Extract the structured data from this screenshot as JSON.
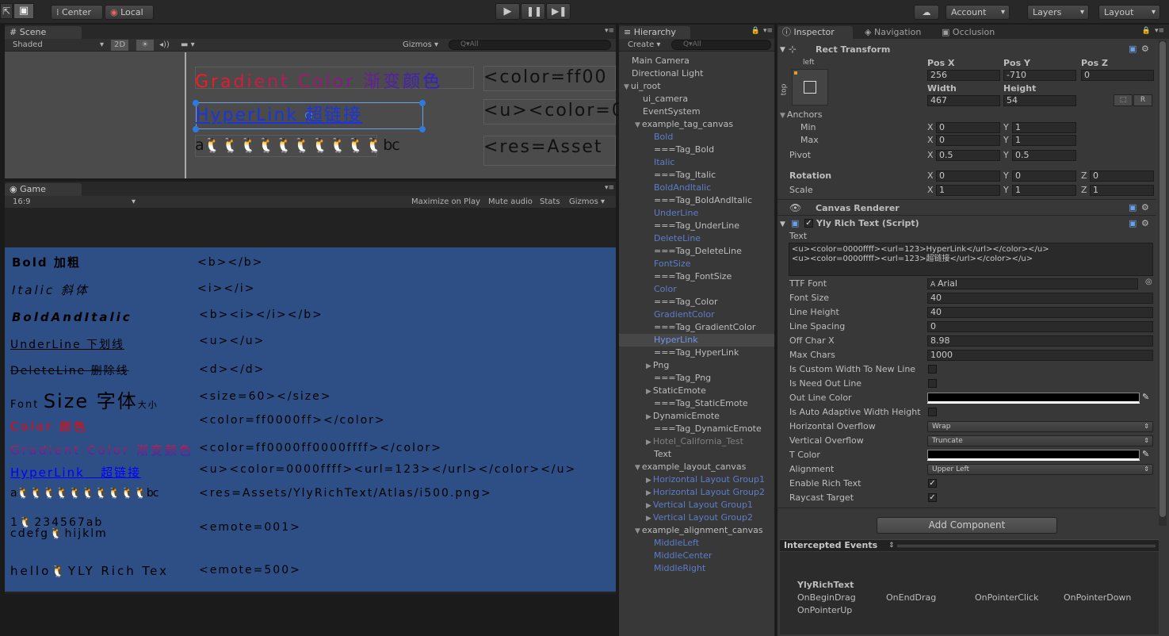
{
  "toolbar": {
    "pivot": "Center",
    "space": "Local",
    "account": "Account",
    "layers": "Layers",
    "layout": "Layout"
  },
  "scene": {
    "tab": "Scene",
    "shading": "Shaded",
    "mode2d": "2D",
    "gizmos": "Gizmos",
    "search_placeholder": "Q▾All",
    "left": [
      {
        "text": "Gradient Color 渐变颜色",
        "color": "#2b1fd0"
      },
      {
        "text": "HyperLink  超链接",
        "color": "#1a35e0"
      },
      {
        "text": "a🐧🐧🐧🐧🐧🐧🐧🐧🐧🐧bc",
        "color": "#111111"
      }
    ],
    "right": [
      "<color=ff00",
      "<u><color=0",
      "<res=Asset"
    ]
  },
  "game": {
    "tab": "Game",
    "aspect": "16:9",
    "maximize": "Maximize on Play",
    "mute": "Mute audio",
    "stats": "Stats",
    "gizmos": "Gizmos",
    "rows": [
      {
        "left": "Bold  加粗",
        "tag": "<b></b>"
      },
      {
        "left": "Italic  斜体",
        "tag": "<i></i>"
      },
      {
        "left": "BoldAndItalic",
        "tag": "<b><i></i></b>"
      },
      {
        "left": "UnderLine  下划线",
        "tag": "<u></u>"
      },
      {
        "left": "DeleteLine  删除线",
        "tag": "<d></d>"
      },
      {
        "left_small": "Font",
        "left_big": "Size  字体",
        "left_tail": "大小",
        "tag": "<size=60></size>"
      },
      {
        "left": "Color  颜色",
        "tag": "<color=ff0000ff></color>"
      },
      {
        "left": "Gradient Color  渐变颜色",
        "tag": "<color=ff0000ff0000ffff></color>"
      },
      {
        "left_a": "HyperLink",
        "left_b": "超链接",
        "tag": "<u><color=0000ffff><url=123></url></color></u>"
      },
      {
        "left": "a🐧🐧🐧🐧🐧🐧🐧🐧🐧🐧bc",
        "tag": "<res=Assets/YlyRichText/Atlas/i500.png>"
      },
      {
        "left1": "1🐧234567ab",
        "left2": "cdefg🐧hijklm",
        "tag": "<emote=001>"
      },
      {
        "left": "hello🐧YLY Rich Tex",
        "tag": "<emote=500>"
      }
    ]
  },
  "hierarchy": {
    "tab": "Hierarchy",
    "create": "Create",
    "search_placeholder": "Q▾All",
    "items": [
      {
        "label": "Main Camera",
        "indent": 0,
        "style": "normal",
        "arrow": ""
      },
      {
        "label": "Directional Light",
        "indent": 0,
        "style": "normal",
        "arrow": ""
      },
      {
        "label": "ui_root",
        "indent": 0,
        "style": "normal",
        "arrow": "▼"
      },
      {
        "label": "ui_camera",
        "indent": 1,
        "style": "normal",
        "arrow": ""
      },
      {
        "label": "EventSystem",
        "indent": 1,
        "style": "normal",
        "arrow": ""
      },
      {
        "label": "example_tag_canvas",
        "indent": 1,
        "style": "normal",
        "arrow": "▼"
      },
      {
        "label": "Bold",
        "indent": 2,
        "style": "blue",
        "arrow": ""
      },
      {
        "label": "===Tag_Bold",
        "indent": 2,
        "style": "normal",
        "arrow": ""
      },
      {
        "label": "Italic",
        "indent": 2,
        "style": "blue",
        "arrow": ""
      },
      {
        "label": "===Tag_Italic",
        "indent": 2,
        "style": "normal",
        "arrow": ""
      },
      {
        "label": "BoldAndItalic",
        "indent": 2,
        "style": "blue",
        "arrow": ""
      },
      {
        "label": "===Tag_BoldAndItalic",
        "indent": 2,
        "style": "normal",
        "arrow": ""
      },
      {
        "label": "UnderLine",
        "indent": 2,
        "style": "blue",
        "arrow": ""
      },
      {
        "label": "===Tag_UnderLine",
        "indent": 2,
        "style": "normal",
        "arrow": ""
      },
      {
        "label": "DeleteLine",
        "indent": 2,
        "style": "blue",
        "arrow": ""
      },
      {
        "label": "===Tag_DeleteLine",
        "indent": 2,
        "style": "normal",
        "arrow": ""
      },
      {
        "label": "FontSize",
        "indent": 2,
        "style": "blue",
        "arrow": ""
      },
      {
        "label": "===Tag_FontSize",
        "indent": 2,
        "style": "normal",
        "arrow": ""
      },
      {
        "label": "Color",
        "indent": 2,
        "style": "blue",
        "arrow": ""
      },
      {
        "label": "===Tag_Color",
        "indent": 2,
        "style": "normal",
        "arrow": ""
      },
      {
        "label": "GradientColor",
        "indent": 2,
        "style": "blue",
        "arrow": ""
      },
      {
        "label": "===Tag_GradientColor",
        "indent": 2,
        "style": "normal",
        "arrow": ""
      },
      {
        "label": "HyperLink",
        "indent": 2,
        "style": "selected",
        "arrow": ""
      },
      {
        "label": "===Tag_HyperLink",
        "indent": 2,
        "style": "normal",
        "arrow": ""
      },
      {
        "label": "Png",
        "indent": 2,
        "style": "normal",
        "arrow": "▶"
      },
      {
        "label": "===Tag_Png",
        "indent": 2,
        "style": "normal",
        "arrow": ""
      },
      {
        "label": "StaticEmote",
        "indent": 2,
        "style": "normal",
        "arrow": "▶"
      },
      {
        "label": "===Tag_StaticEmote",
        "indent": 2,
        "style": "normal",
        "arrow": ""
      },
      {
        "label": "DynamicEmote",
        "indent": 2,
        "style": "normal",
        "arrow": "▶"
      },
      {
        "label": "===Tag_DynamicEmote",
        "indent": 2,
        "style": "normal",
        "arrow": ""
      },
      {
        "label": "Hotel_California_Test",
        "indent": 2,
        "style": "gray",
        "arrow": "▶"
      },
      {
        "label": "Text",
        "indent": 2,
        "style": "normal",
        "arrow": ""
      },
      {
        "label": "example_layout_canvas",
        "indent": 1,
        "style": "normal",
        "arrow": "▼"
      },
      {
        "label": "Horizontal Layout Group1",
        "indent": 2,
        "style": "blue",
        "arrow": "▶"
      },
      {
        "label": "Horizontal Layout Group2",
        "indent": 2,
        "style": "blue",
        "arrow": "▶"
      },
      {
        "label": "Vertical Layout Group1",
        "indent": 2,
        "style": "blue",
        "arrow": "▶"
      },
      {
        "label": "Vertical Layout Group2",
        "indent": 2,
        "style": "blue",
        "arrow": "▶"
      },
      {
        "label": "example_alignment_canvas",
        "indent": 1,
        "style": "normal",
        "arrow": "▼"
      },
      {
        "label": "MiddleLeft",
        "indent": 2,
        "style": "blue",
        "arrow": ""
      },
      {
        "label": "MiddleCenter",
        "indent": 2,
        "style": "blue",
        "arrow": ""
      },
      {
        "label": "MiddleRight",
        "indent": 2,
        "style": "blue",
        "arrow": ""
      }
    ]
  },
  "inspector": {
    "tab": "Inspector",
    "tab_nav": "Navigation",
    "tab_occ": "Occlusion",
    "rect_title": "Rect Transform",
    "anchor_left": "left",
    "anchor_top": "top",
    "posx_label": "Pos X",
    "posy_label": "Pos Y",
    "posz_label": "Pos Z",
    "posx": "256",
    "posy": "-710",
    "posz": "0",
    "width_label": "Width",
    "height_label": "Height",
    "width": "467",
    "height": "54",
    "r_btn": "R",
    "anchors": "Anchors",
    "min": "Min",
    "max": "Max",
    "x": "X",
    "y": "Y",
    "z": "Z",
    "min_x": "0",
    "min_y": "1",
    "max_x": "0",
    "max_y": "1",
    "pivot": "Pivot",
    "pivot_x": "0.5",
    "pivot_y": "0.5",
    "rotation": "Rotation",
    "rot_x": "0",
    "rot_y": "0",
    "rot_z": "0",
    "scale": "Scale",
    "scale_x": "1",
    "scale_y": "1",
    "scale_z": "1",
    "canvas_renderer": "Canvas Renderer",
    "script_title": "Yly Rich Text (Script)",
    "text_label": "Text",
    "text_line1": "<u><color=0000ffff><url=123>HyperLink</url></color></u>",
    "text_line2": "<u><color=0000ffff><url=123>超链接</url></color></u>",
    "props": [
      {
        "label": "TTF Font",
        "value": "Arial",
        "kind": "object"
      },
      {
        "label": "Font Size",
        "value": "40",
        "kind": "field"
      },
      {
        "label": "Line Height",
        "value": "40",
        "kind": "field"
      },
      {
        "label": "Line Spacing",
        "value": "0",
        "kind": "field"
      },
      {
        "label": "Off Char X",
        "value": "8.98",
        "kind": "field"
      },
      {
        "label": "Max Chars",
        "value": "1000",
        "kind": "field"
      },
      {
        "label": "Is Custom Width To New Line",
        "value": "",
        "kind": "check"
      },
      {
        "label": "Is Need Out Line",
        "value": "",
        "kind": "check"
      },
      {
        "label": "Out Line Color",
        "value": "#000000",
        "kind": "color"
      },
      {
        "label": "Is Auto Adaptive Width Height",
        "value": "",
        "kind": "check"
      },
      {
        "label": "Horizontal Overflow",
        "value": "Wrap",
        "kind": "select"
      },
      {
        "label": "Vertical Overflow",
        "value": "Truncate",
        "kind": "select"
      },
      {
        "label": "T Color",
        "value": "#000000",
        "kind": "color"
      },
      {
        "label": "Alignment",
        "value": "Upper Left",
        "kind": "select"
      },
      {
        "label": "Enable Rich Text",
        "value": "✓",
        "kind": "check"
      },
      {
        "label": "Raycast Target",
        "value": "✓",
        "kind": "check"
      }
    ],
    "add_component": "Add Component",
    "intercepted": "Intercepted Events",
    "events_title": "YlyRichText",
    "events": [
      "OnBeginDrag",
      "OnEndDrag",
      "OnPointerClick",
      "OnPointerDown",
      "OnPointerUp"
    ]
  },
  "colors": {
    "game_bg": "#2d4f86",
    "scene_bg": "#4b4b4b",
    "link_blue": "#0000ff",
    "red": "#ff0000"
  }
}
